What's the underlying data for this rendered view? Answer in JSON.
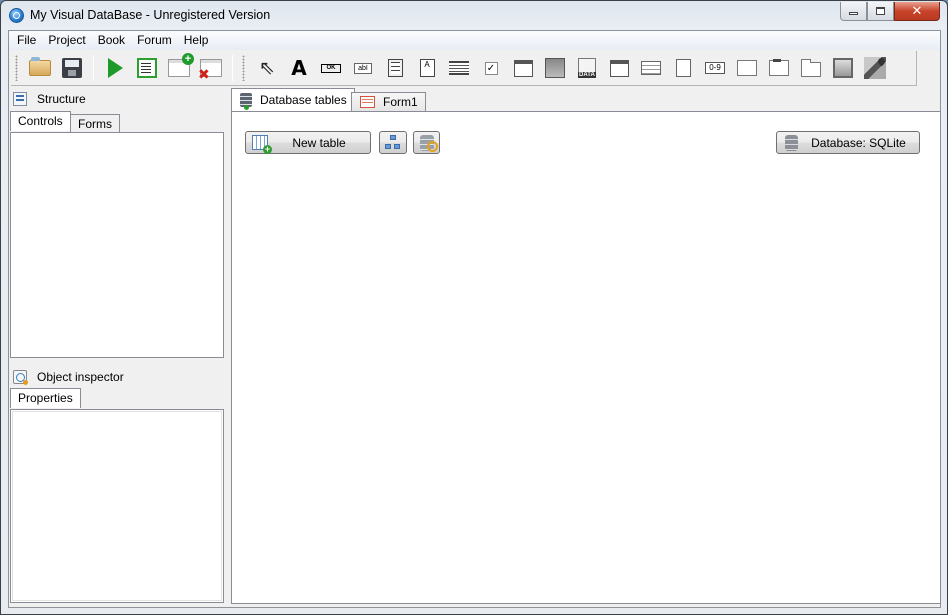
{
  "window": {
    "title": "My Visual DataBase - Unregistered Version",
    "controls": {
      "minimize": "minimize",
      "maximize": "maximize",
      "close": "✕"
    }
  },
  "menu": {
    "items": [
      {
        "label": "File"
      },
      {
        "label": "Project"
      },
      {
        "label": "Book"
      },
      {
        "label": "Forum"
      },
      {
        "label": "Help"
      }
    ]
  },
  "toolbar": {
    "file_buttons": [
      {
        "name": "open-project",
        "icon": "folder-icon"
      },
      {
        "name": "save-project",
        "icon": "floppy-disk-icon"
      },
      {
        "name": "run-project",
        "icon": "play-icon"
      },
      {
        "name": "form-properties",
        "icon": "form-list-icon"
      },
      {
        "name": "add-form",
        "icon": "window-add-icon"
      },
      {
        "name": "delete-form",
        "icon": "window-delete-icon"
      }
    ],
    "components": [
      {
        "name": "pointer",
        "icon": "cursor-arrow-icon"
      },
      {
        "name": "label",
        "icon": "label-A-icon",
        "glyph": "A"
      },
      {
        "name": "button",
        "icon": "button-ok-icon",
        "glyph": "OK"
      },
      {
        "name": "edit",
        "icon": "textbox-icon",
        "glyph": "abI"
      },
      {
        "name": "memo",
        "icon": "memo-icon"
      },
      {
        "name": "rich-text",
        "icon": "rich-text-icon",
        "glyph": "A"
      },
      {
        "name": "combobox",
        "icon": "combobox-icon"
      },
      {
        "name": "checkbox",
        "icon": "checkbox-icon",
        "glyph": "✓"
      },
      {
        "name": "datetime",
        "icon": "calendar-icon"
      },
      {
        "name": "db-image",
        "icon": "db-image-icon"
      },
      {
        "name": "data-file",
        "icon": "data-file-icon"
      },
      {
        "name": "date-picker",
        "icon": "calendar-grid-icon"
      },
      {
        "name": "table-grid",
        "icon": "table-grid-icon"
      },
      {
        "name": "tree-view",
        "icon": "tree-view-icon"
      },
      {
        "name": "numeric-edit",
        "icon": "numeric-icon",
        "glyph": "0-9"
      },
      {
        "name": "panel",
        "icon": "panel-icon"
      },
      {
        "name": "group-box",
        "icon": "group-box-icon"
      },
      {
        "name": "page-control",
        "icon": "page-control-icon"
      },
      {
        "name": "image",
        "icon": "picture-icon"
      },
      {
        "name": "map",
        "icon": "map-icon"
      }
    ]
  },
  "structure_panel": {
    "title": "Structure",
    "tabs": [
      {
        "label": "Controls",
        "active": true
      },
      {
        "label": "Forms",
        "active": false
      }
    ]
  },
  "inspector_panel": {
    "title": "Object inspector",
    "tabs": [
      {
        "label": "Properties",
        "active": true
      }
    ]
  },
  "main": {
    "tabs": [
      {
        "label": "Database tables",
        "active": true
      },
      {
        "label": "Form1",
        "active": false
      }
    ],
    "new_table_label": "New table",
    "relations_button": "relations",
    "db_settings_button": "db-settings",
    "database_label": "Database: SQLite"
  }
}
